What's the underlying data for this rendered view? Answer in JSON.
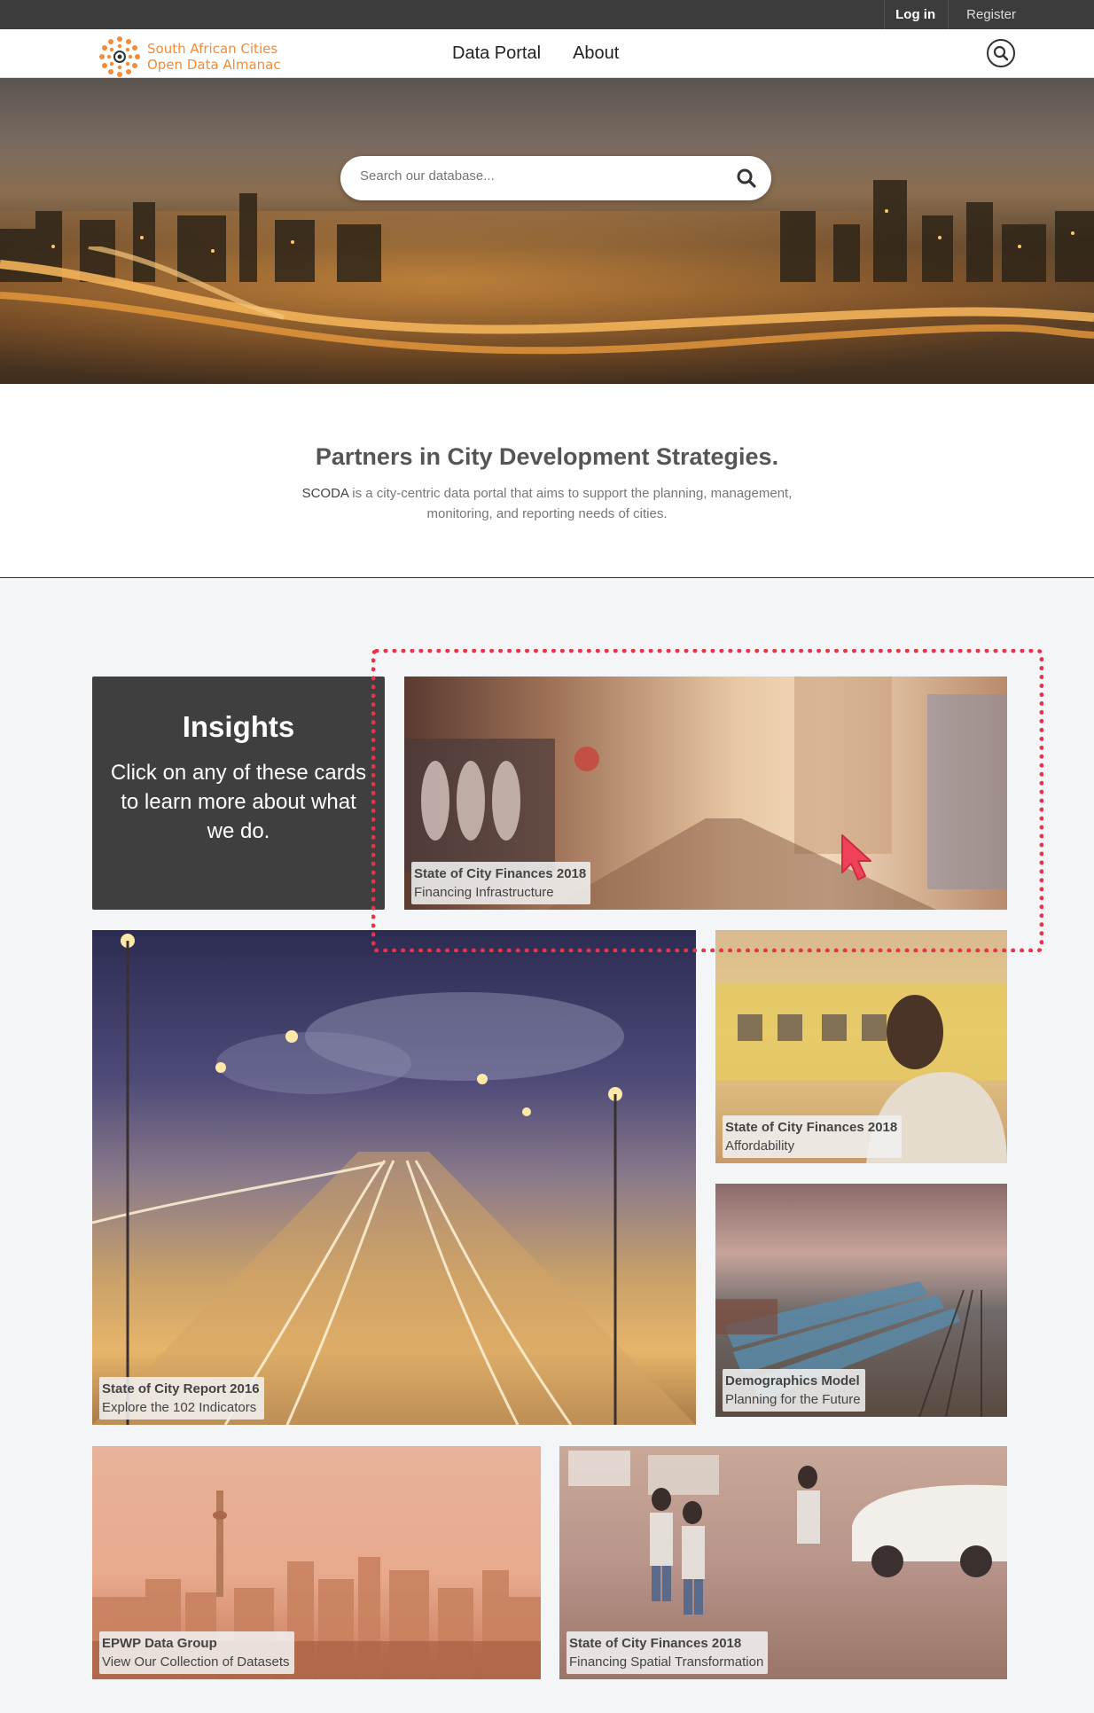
{
  "topbar": {
    "login": "Log in",
    "register": "Register"
  },
  "nav": {
    "logo_line1": "South African Cities",
    "logo_line2": "Open Data Almanac",
    "links": [
      "Data Portal",
      "About"
    ]
  },
  "hero": {
    "search_placeholder": "Search our database..."
  },
  "intro": {
    "title": "Partners in City Development Strategies.",
    "brand": "SCODA",
    "description": " is a city-centric data portal that aims to support the planning, management, monitoring, and reporting needs of cities."
  },
  "insights": {
    "title": "Insights",
    "text": "Click on any of these cards to learn more about what we do."
  },
  "cards": [
    {
      "title": "State of City Finances 2018",
      "subtitle": "Financing Infrastructure"
    },
    {
      "title": "State of City Report 2016",
      "subtitle": "Explore the 102 Indicators"
    },
    {
      "title": "State of City Finances 2018",
      "subtitle": "Affordability"
    },
    {
      "title": "Demographics Model",
      "subtitle": "Planning for the Future"
    },
    {
      "title": "EPWP Data Group",
      "subtitle": "View Our Collection of Datasets"
    },
    {
      "title": "State of City Finances 2018",
      "subtitle": "Financing Spatial Transformation"
    }
  ],
  "colors": {
    "accent": "#e8344a",
    "brand_orange": "#f08c3a",
    "dark": "#3f3f3f"
  }
}
